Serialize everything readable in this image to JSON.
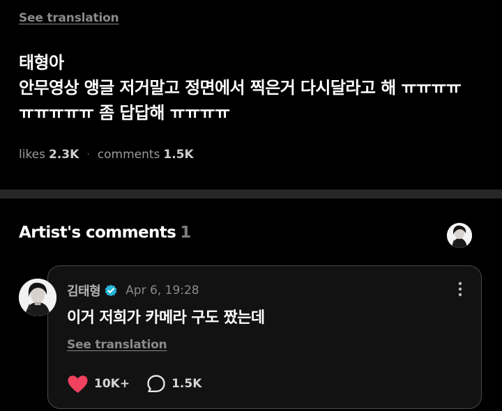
{
  "post": {
    "see_translation": "See translation",
    "body_lines": [
      "태형아",
      "안무영상 앵글 저거말고 정면에서 찍은거 다시달라고 해 ㅠㅠㅠㅠ",
      "ㅠㅠㅠㅠㅠ 좀 답답해 ㅠㅠㅠㅠ"
    ],
    "likes_label": "likes",
    "likes_count": "2.3K",
    "separator": "·",
    "comments_label": "comments",
    "comments_count": "1.5K"
  },
  "artist_comments": {
    "title": "Artist's comments",
    "count": "1"
  },
  "comment": {
    "author": "김태형",
    "time": "Apr 6, 19:28",
    "text": "이거 저희가 카메라 구도 짰는데",
    "see_translation": "See translation",
    "likes": "10K+",
    "replies": "1.5K"
  },
  "colors": {
    "background": "#000000",
    "divider": "#262626",
    "card_background": "#121212",
    "card_border": "#4a4a4a",
    "heart": "#f0415f",
    "verified": "#25b6d9"
  },
  "icons": {
    "verified": "verified-badge-icon",
    "more": "more-vertical-icon",
    "like": "heart-icon",
    "reply": "comment-bubble-icon",
    "avatar": "profile-photo"
  }
}
